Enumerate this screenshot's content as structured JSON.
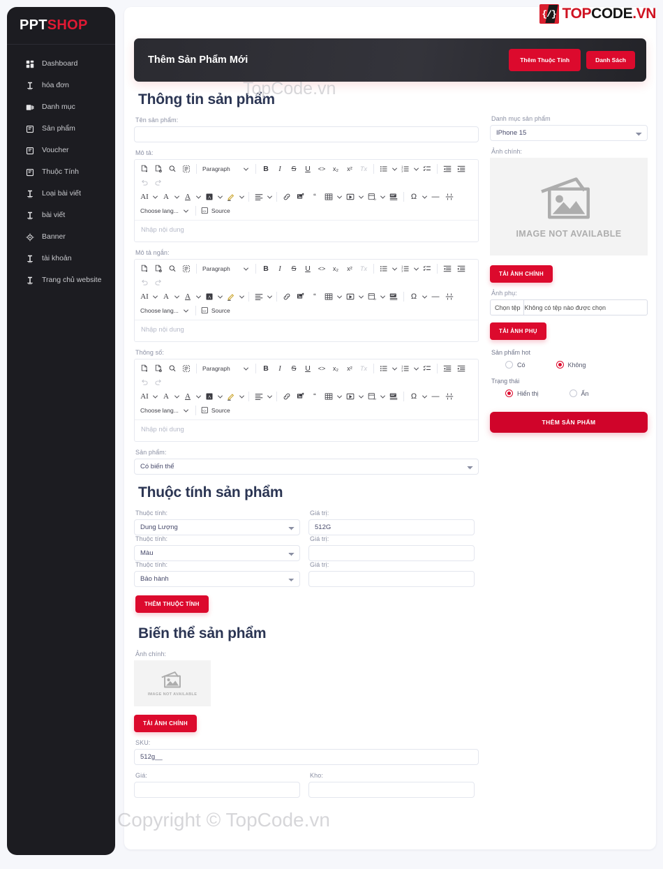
{
  "brand": {
    "part1": "PPT",
    "part2": "SHOP"
  },
  "logo": {
    "badge": "{/}",
    "top": "TOP",
    "code": "CODE",
    "vn": ".VN"
  },
  "watermarks": {
    "top": "TopCode.vn",
    "bottom": "Copyright © TopCode.vn"
  },
  "sidebar": {
    "items": [
      {
        "label": "Dashboard",
        "icon": "grid-icon"
      },
      {
        "label": "hóa đơn",
        "icon": "receipt-icon"
      },
      {
        "label": "Danh mục",
        "icon": "layers-icon"
      },
      {
        "label": "Sản phẩm",
        "icon": "box-icon"
      },
      {
        "label": "Voucher",
        "icon": "box-icon"
      },
      {
        "label": "Thuộc Tính",
        "icon": "box-icon"
      },
      {
        "label": "Loại bài viết",
        "icon": "receipt-icon"
      },
      {
        "label": "bài viết",
        "icon": "receipt-icon"
      },
      {
        "label": "Banner",
        "icon": "target-icon"
      },
      {
        "label": "tài khoản",
        "icon": "receipt-icon"
      },
      {
        "label": "Trang chủ website",
        "icon": "receipt-icon"
      }
    ]
  },
  "header": {
    "title": "Thêm Sản Phẩm Mới",
    "btn_add_attr": "Thêm Thuộc Tính",
    "btn_list": "Danh Sách"
  },
  "sections": {
    "product_info": "Thông tin sản phẩm",
    "product_attrs": "Thuộc tính sản phẩm",
    "product_variants": "Biến thể sản phẩm"
  },
  "labels": {
    "product_name": "Tên sản phẩm:",
    "description": "Mô tả:",
    "short_description": "Mô tả ngắn:",
    "specs": "Thông số:",
    "product_type": "Sản phẩm:",
    "category": "Danh mục sản phẩm",
    "main_image": "Ảnh chính:",
    "extra_image": "Ảnh phụ:",
    "hot_product": "Sản phẩm hot",
    "status": "Trạng thái",
    "attribute": "Thuộc tính:",
    "value": "Giá trị:",
    "sku": "SKU:",
    "price": "Giá:",
    "stock": "Kho:"
  },
  "values": {
    "product_name": "",
    "category": "IPhone 15",
    "product_type": "Có biến thể",
    "sku": "512g__",
    "price": "",
    "stock": ""
  },
  "placeholders": {
    "editor": "Nhập nội dung"
  },
  "file_input": {
    "button": "Chọn tệp",
    "name": "Không có tệp nào được chọn"
  },
  "buttons": {
    "upload_main": "TẢI ẢNH CHÍNH",
    "upload_extra": "TẢI ẢNH PHỤ",
    "add_product": "THÊM SẢN PHẨM",
    "add_attribute": "THÊM THUỘC TÍNH",
    "upload_main_variant": "TẢI ẢNH CHÍNH"
  },
  "radios": {
    "hot_yes": "Có",
    "hot_no": "Không",
    "status_show": "Hiển thị",
    "status_hide": "Ẩn"
  },
  "image_placeholder": {
    "caption": "IMAGE NOT AVAILABLE"
  },
  "editor_toolbar": {
    "paragraph": "Paragraph",
    "language": "Choose lang...",
    "source": "Source",
    "bold": "B",
    "italic": "I",
    "strike": "S",
    "underline": "U",
    "code": "<>",
    "subscript": "x₂",
    "superscript": "x²",
    "remove_format": "Tx",
    "font_size": "A",
    "font_family": "AI",
    "special_char": "Ω",
    "horizontal_line": "—"
  },
  "attributes": [
    {
      "name": "Dung Lượng",
      "value": "512G"
    },
    {
      "name": "Màu",
      "value": ""
    },
    {
      "name": "Bảo hành",
      "value": ""
    }
  ],
  "colors": {
    "accent_red": "#dc0a2d",
    "brand_red": "#e01933",
    "sidebar_bg": "#1c1c21",
    "header_bg": "#2b2b31",
    "heading": "#2b3553",
    "page_bg": "#f6f7fb"
  }
}
